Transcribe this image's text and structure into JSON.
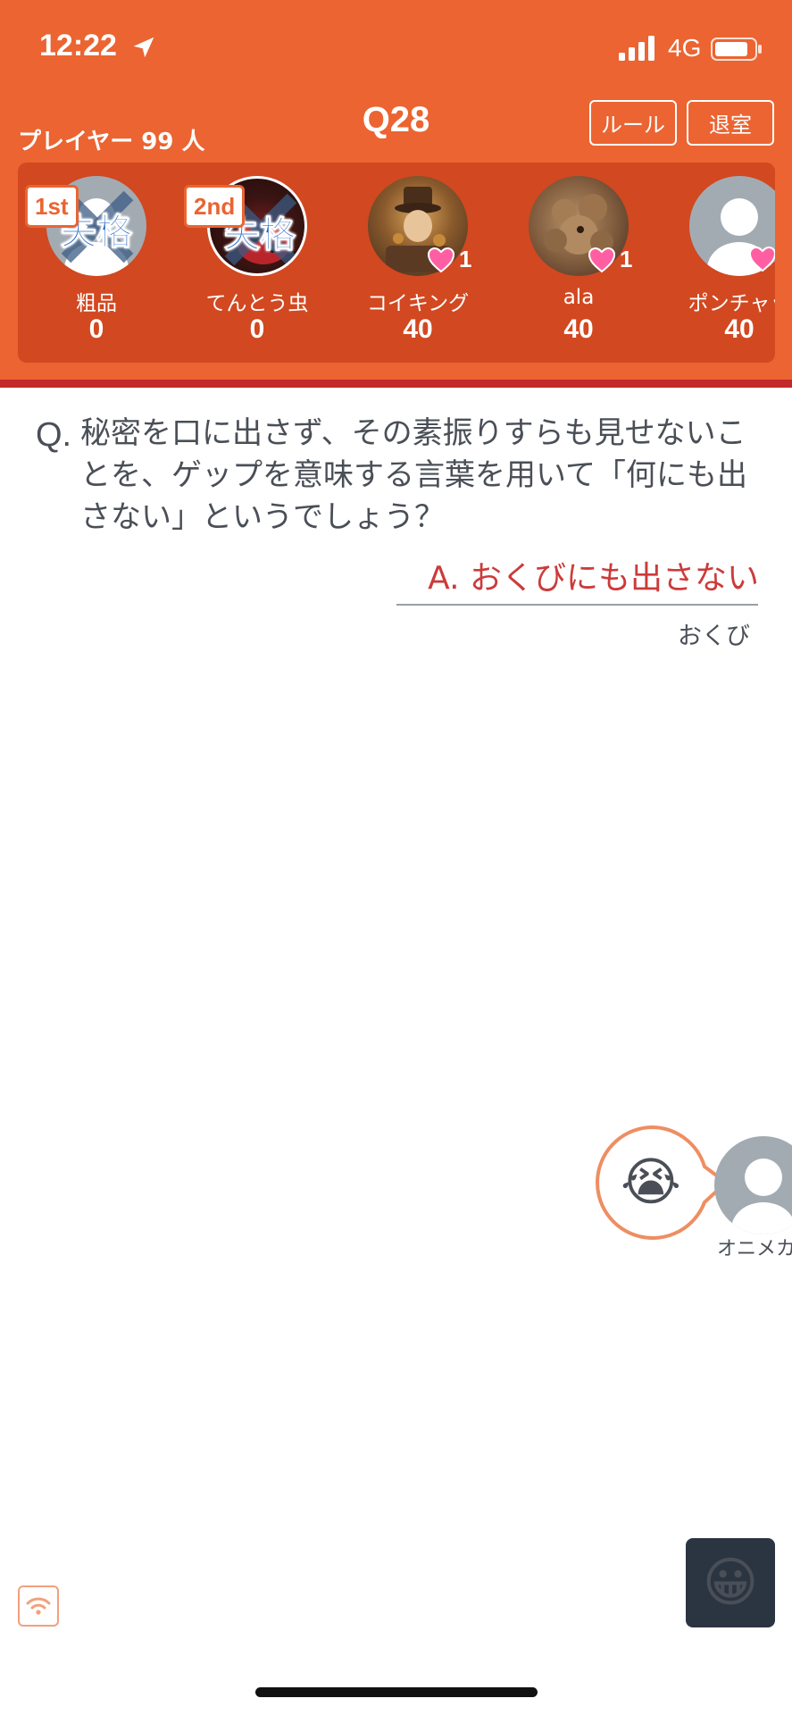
{
  "status_bar": {
    "time": "12:22",
    "network": "4G"
  },
  "header": {
    "players_label": "プレイヤー 99 人",
    "question_number": "Q28",
    "rule_button": "ルール",
    "exit_button": "退室"
  },
  "players": [
    {
      "rank": "1st",
      "name": "粗品",
      "score": "0",
      "status": "失格",
      "avatar": "default-avatar"
    },
    {
      "rank": "2nd",
      "name": "てんとう虫",
      "score": "0",
      "status": "失格",
      "avatar": "ladybug-photo"
    },
    {
      "name": "コイキング",
      "score": "40",
      "hearts": "1",
      "avatar": "steampunk-photo"
    },
    {
      "name": "ala",
      "score": "40",
      "hearts": "1",
      "avatar": "dog-photo"
    },
    {
      "name": "ポンチャッ",
      "score": "40",
      "avatar": "default-avatar"
    }
  ],
  "question": {
    "prefix": "Q.",
    "text": "秘密を口に出さず、その素振りすらも見せないことを、ゲップを意味する言葉を用いて「何にも出さない」というでしょう？",
    "answer": "A. おくびにも出さない",
    "reading": "おくび"
  },
  "reaction": {
    "emoji": "😭",
    "user_name": "オニメカ"
  },
  "controls": {
    "emoji_button": "😀"
  },
  "colors": {
    "header": "#eb6431",
    "panel": "#d24820",
    "answer": "#cc3b3b",
    "emoji_button": "#2b3542"
  }
}
